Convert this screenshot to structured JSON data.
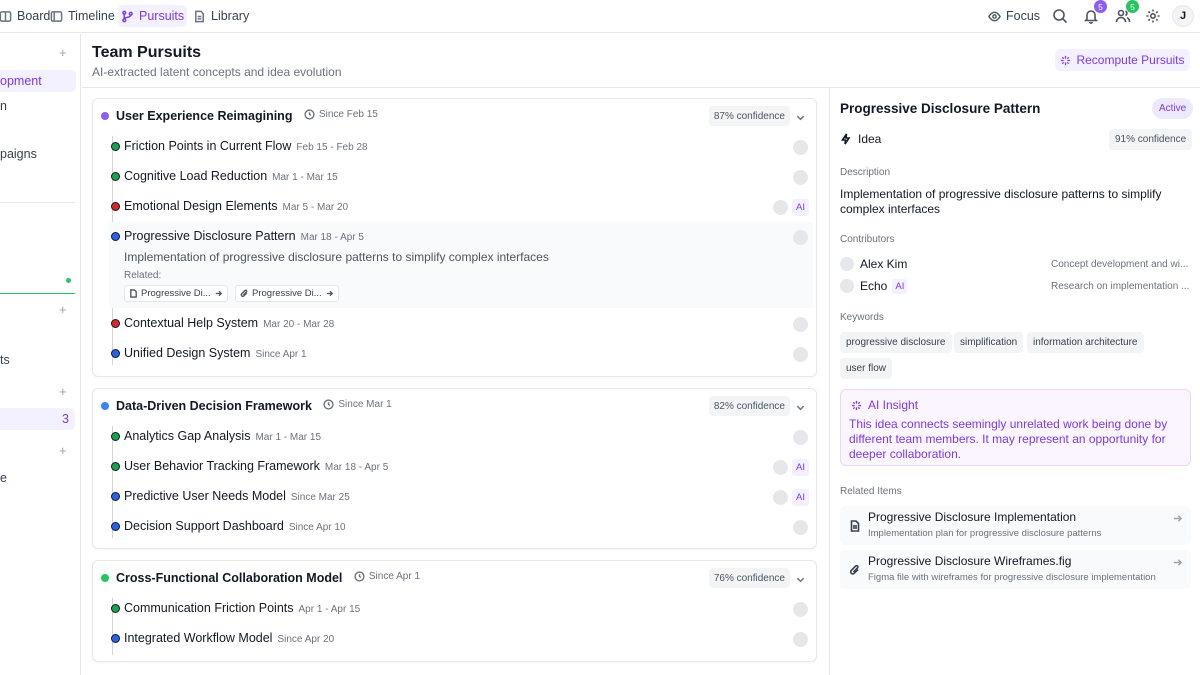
{
  "nav": {
    "items": [
      {
        "label": "Board",
        "icon": "board-icon"
      },
      {
        "label": "Timeline",
        "icon": "timeline-icon"
      },
      {
        "label": "Pursuits",
        "icon": "branch-icon",
        "active": true
      },
      {
        "label": "Library",
        "icon": "document-icon"
      }
    ],
    "focus_label": "Focus",
    "notifications_count": "5",
    "team_count": "5",
    "avatar_initial": "J"
  },
  "sidebar": {
    "items": [
      {
        "label": "opment",
        "active": true
      },
      {
        "label": "n"
      },
      {
        "label": "paigns"
      },
      {
        "label": "ts"
      },
      {
        "label": "3"
      },
      {
        "label": "e"
      }
    ],
    "plus": "+"
  },
  "header": {
    "title": "Team Pursuits",
    "subtitle": "AI-extracted latent concepts and idea evolution",
    "recompute_label": "Recompute Pursuits"
  },
  "pursuits": [
    {
      "title": "User Experience Reimagining",
      "since": "Since Feb 15",
      "confidence": "87% confidence",
      "color": "#8b5cf6",
      "items": [
        {
          "label": "Friction Points in Current Flow",
          "date": "Feb 15 - Feb 28",
          "dot": "#16a34a"
        },
        {
          "label": "Cognitive Load Reduction",
          "date": "Mar 1 - Mar 15",
          "dot": "#16a34a"
        },
        {
          "label": "Emotional Design Elements",
          "date": "Mar 5 - Mar 20",
          "dot": "#dc2626",
          "ai": "AI"
        },
        {
          "label": "Progressive Disclosure Pattern",
          "date": "Mar 18 - Apr 5",
          "dot": "#2563eb",
          "description": "Implementation of progressive disclosure patterns to simplify complex interfaces",
          "related_label": "Related:",
          "related": [
            "Progressive Di...",
            "Progressive Di..."
          ]
        },
        {
          "label": "Contextual Help System",
          "date": "Mar 20 - Mar 28",
          "dot": "#dc2626"
        },
        {
          "label": "Unified Design System",
          "date": "Since Apr 1",
          "dot": "#2563eb"
        }
      ]
    },
    {
      "title": "Data-Driven Decision Framework",
      "since": "Since Mar 1",
      "confidence": "82% confidence",
      "color": "#3b82f6",
      "items": [
        {
          "label": "Analytics Gap Analysis",
          "date": "Mar 1 - Mar 15",
          "dot": "#16a34a"
        },
        {
          "label": "User Behavior Tracking Framework",
          "date": "Mar 18 - Apr 5",
          "dot": "#16a34a",
          "ai": "AI"
        },
        {
          "label": "Predictive User Needs Model",
          "date": "Since Mar 25",
          "dot": "#2563eb",
          "ai": "AI"
        },
        {
          "label": "Decision Support Dashboard",
          "date": "Since Apr 10",
          "dot": "#2563eb"
        }
      ]
    },
    {
      "title": "Cross-Functional Collaboration Model",
      "since": "Since Apr 1",
      "confidence": "76% confidence",
      "color": "#22c55e",
      "items": [
        {
          "label": "Communication Friction Points",
          "date": "Apr 1 - Apr 15",
          "dot": "#16a34a"
        },
        {
          "label": "Integrated Workflow Model",
          "date": "Since Apr 20",
          "dot": "#2563eb"
        }
      ]
    }
  ],
  "detail": {
    "title": "Progressive Disclosure Pattern",
    "status": "Active",
    "type": "Idea",
    "confidence": "91% confidence",
    "description_label": "Description",
    "description": "Implementation of progressive disclosure patterns to simplify complex interfaces",
    "contributors_label": "Contributors",
    "contributors": [
      {
        "name": "Alex Kim",
        "role": "Concept development and wi..."
      },
      {
        "name": "Echo",
        "ai": "AI",
        "role": "Research on implementation ..."
      }
    ],
    "keywords_label": "Keywords",
    "keywords": [
      "progressive disclosure",
      "simplification",
      "information architecture",
      "user flow"
    ],
    "insight_title": "AI Insight",
    "insight_body": "This idea connects seemingly unrelated work being done by different team members. It may represent an opportunity for deeper collaboration.",
    "related_label": "Related Items",
    "related_items": [
      {
        "title": "Progressive Disclosure Implementation",
        "subtitle": "Implementation plan for progressive disclosure patterns",
        "icon": "document-icon"
      },
      {
        "title": "Progressive Disclosure Wireframes.fig",
        "subtitle": "Figma file with wireframes for progressive disclosure implementation",
        "icon": "paperclip-icon"
      }
    ]
  },
  "colors": {
    "accent": "#7c3aed",
    "notif_badge": "#8b5cf6",
    "team_badge": "#22c55e"
  }
}
